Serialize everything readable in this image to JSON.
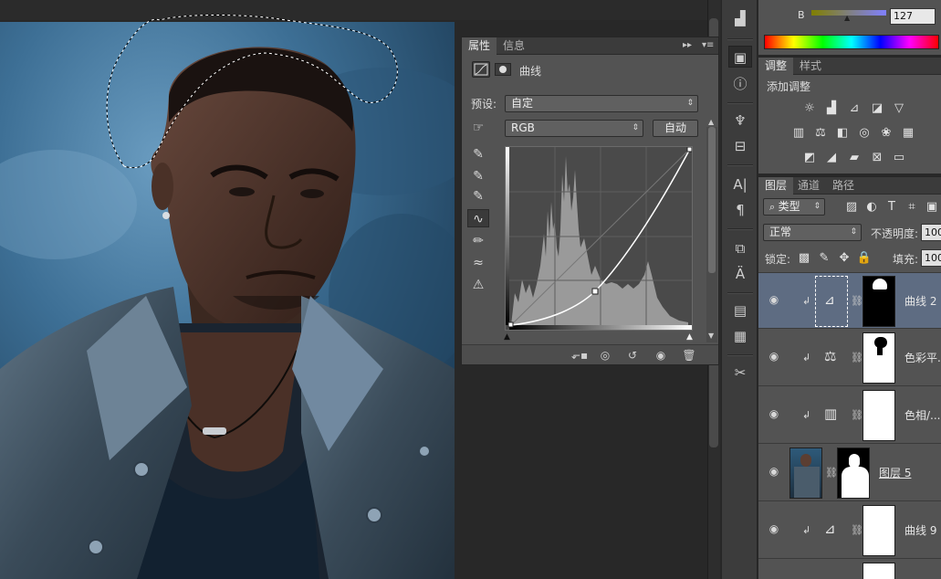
{
  "properties_panel": {
    "tabs": [
      "属性",
      "信息"
    ],
    "header_title": "曲线",
    "preset_label": "预设:",
    "preset_value": "自定",
    "channel_value": "RGB",
    "auto_button": "自动"
  },
  "color_panel": {
    "b_label": "B",
    "b_value": "127"
  },
  "adjustments_panel": {
    "tabs": [
      "调整",
      "样式"
    ],
    "title": "添加调整"
  },
  "layers_panel": {
    "tabs": [
      "图层",
      "通道",
      "路径"
    ],
    "filter_label": "类型",
    "blend_mode": "正常",
    "opacity_label": "不透明度:",
    "opacity_value": "100",
    "lock_label": "锁定:",
    "fill_label": "填充:",
    "fill_value": "100",
    "layers": [
      {
        "name": "曲线 2",
        "selected": true
      },
      {
        "name": "色彩平..."
      },
      {
        "name": "色相/..."
      },
      {
        "name": "图层 5"
      },
      {
        "name": "曲线 9"
      }
    ]
  },
  "colors": {
    "panel_bg": "#535353",
    "selection": "#5e6c82",
    "canvas_bg": "#282828"
  }
}
